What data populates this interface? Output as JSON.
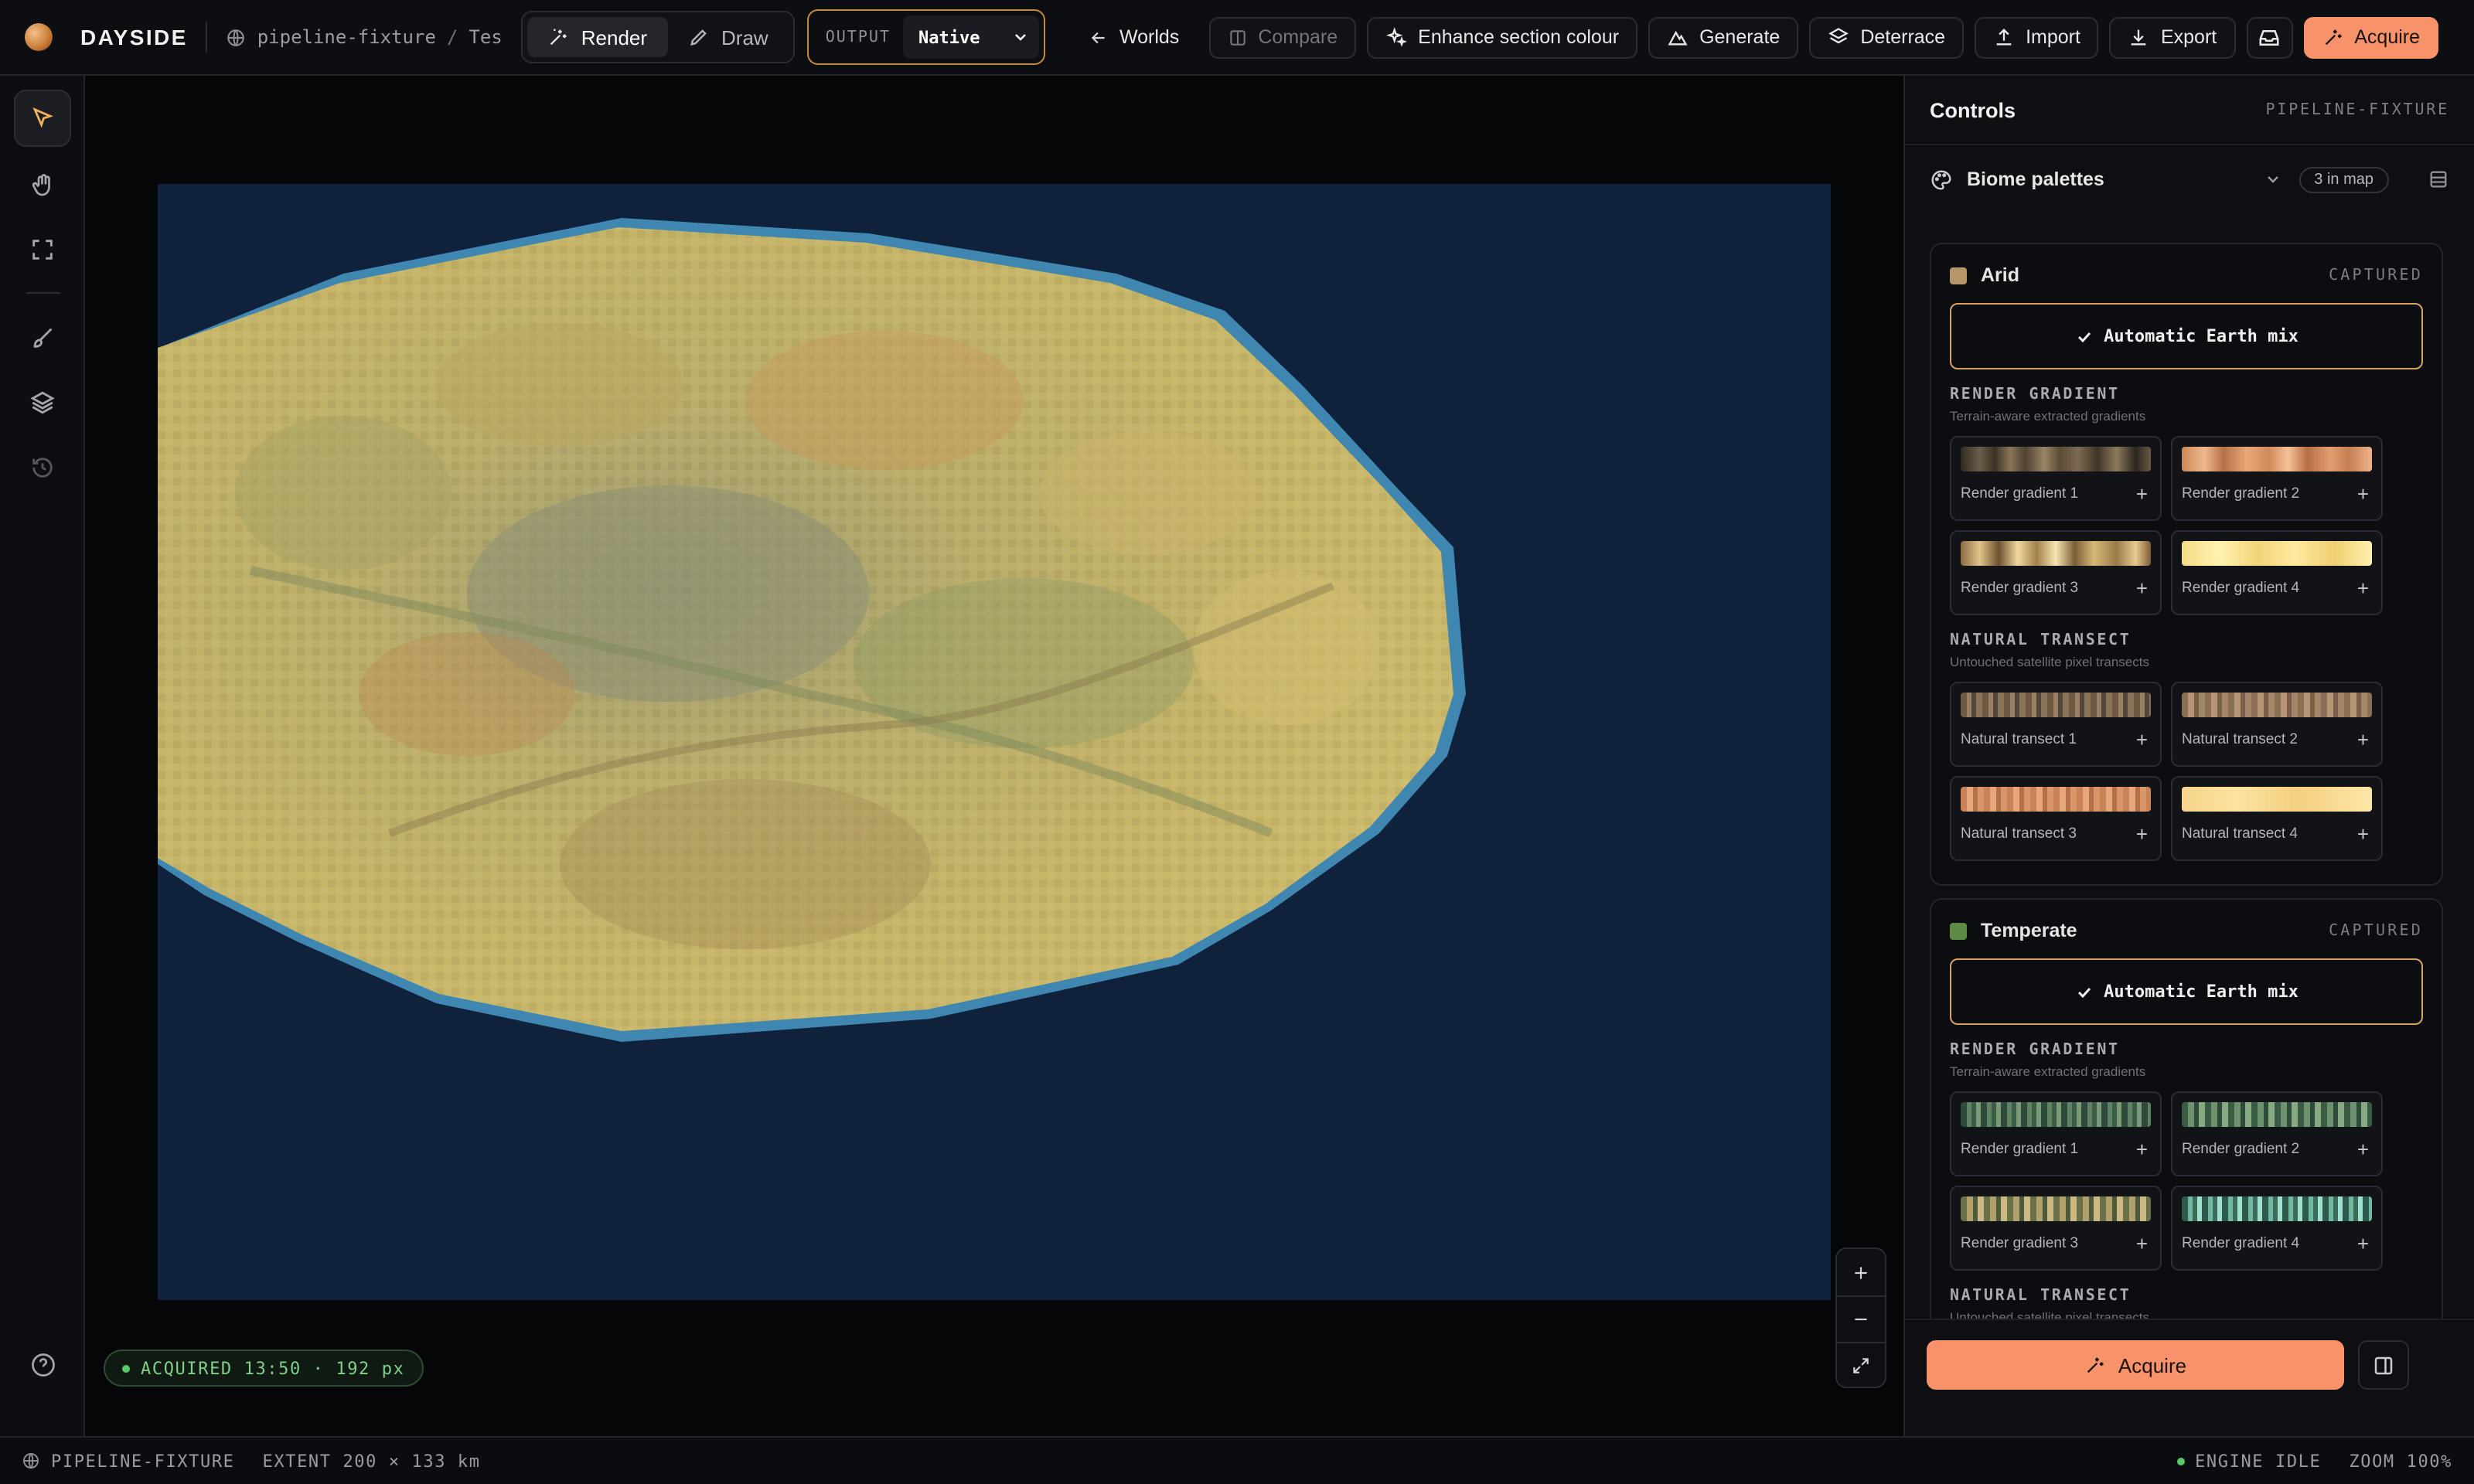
{
  "header": {
    "brand": "DAYSIDE",
    "breadcrumb_project": "pipeline-fixture",
    "breadcrumb_sep": "/",
    "breadcrumb_world": "Tes",
    "modes": [
      {
        "label": "Render",
        "active": true
      },
      {
        "label": "Draw",
        "active": false
      }
    ],
    "output_label": "OUTPUT",
    "output_value": "Native",
    "worlds": "Worlds",
    "compare": "Compare",
    "enhance": "Enhance section colour",
    "generate": "Generate",
    "deterrace": "Deterrace",
    "import": "Import",
    "export": "Export",
    "acquire": "Acquire"
  },
  "canvas": {
    "acquired_badge": "ACQUIRED 13:50 · 192 px"
  },
  "panel": {
    "title": "Controls",
    "project": "PIPELINE-FIXTURE",
    "biome_palettes": "Biome palettes",
    "in_map": "3 in map",
    "biomes": [
      {
        "name": "Arid",
        "status": "CAPTURED",
        "color": "#b69569",
        "auto_label": "Automatic Earth mix",
        "render_heading": "RENDER GRADIENT",
        "render_sub": "Terrain-aware extracted gradients",
        "render_tiles": [
          "Render gradient 1",
          "Render gradient 2",
          "Render gradient 3",
          "Render gradient 4"
        ],
        "transect_heading": "NATURAL TRANSECT",
        "transect_sub": "Untouched satellite pixel transects",
        "transect_tiles": [
          "Natural transect 1",
          "Natural transect 2",
          "Natural transect 3",
          "Natural transect 4"
        ]
      },
      {
        "name": "Temperate",
        "status": "CAPTURED",
        "color": "#5f8a45",
        "auto_label": "Automatic Earth mix",
        "render_heading": "RENDER GRADIENT",
        "render_sub": "Terrain-aware extracted gradients",
        "render_tiles": [
          "Render gradient 1",
          "Render gradient 2",
          "Render gradient 3",
          "Render gradient 4"
        ],
        "transect_heading": "NATURAL TRANSECT",
        "transect_sub": "Untouched satellite pixel transects"
      }
    ],
    "footer_acquire": "Acquire"
  },
  "status": {
    "project": "PIPELINE-FIXTURE",
    "extent": "EXTENT 200 × 133 km",
    "engine": "ENGINE IDLE",
    "zoom": "ZOOM 100%"
  },
  "colors": {
    "accent": "#f7926a",
    "outline_gold": "#d6a25e",
    "ocean": "#0f213b",
    "ok_green": "#58c86a"
  }
}
